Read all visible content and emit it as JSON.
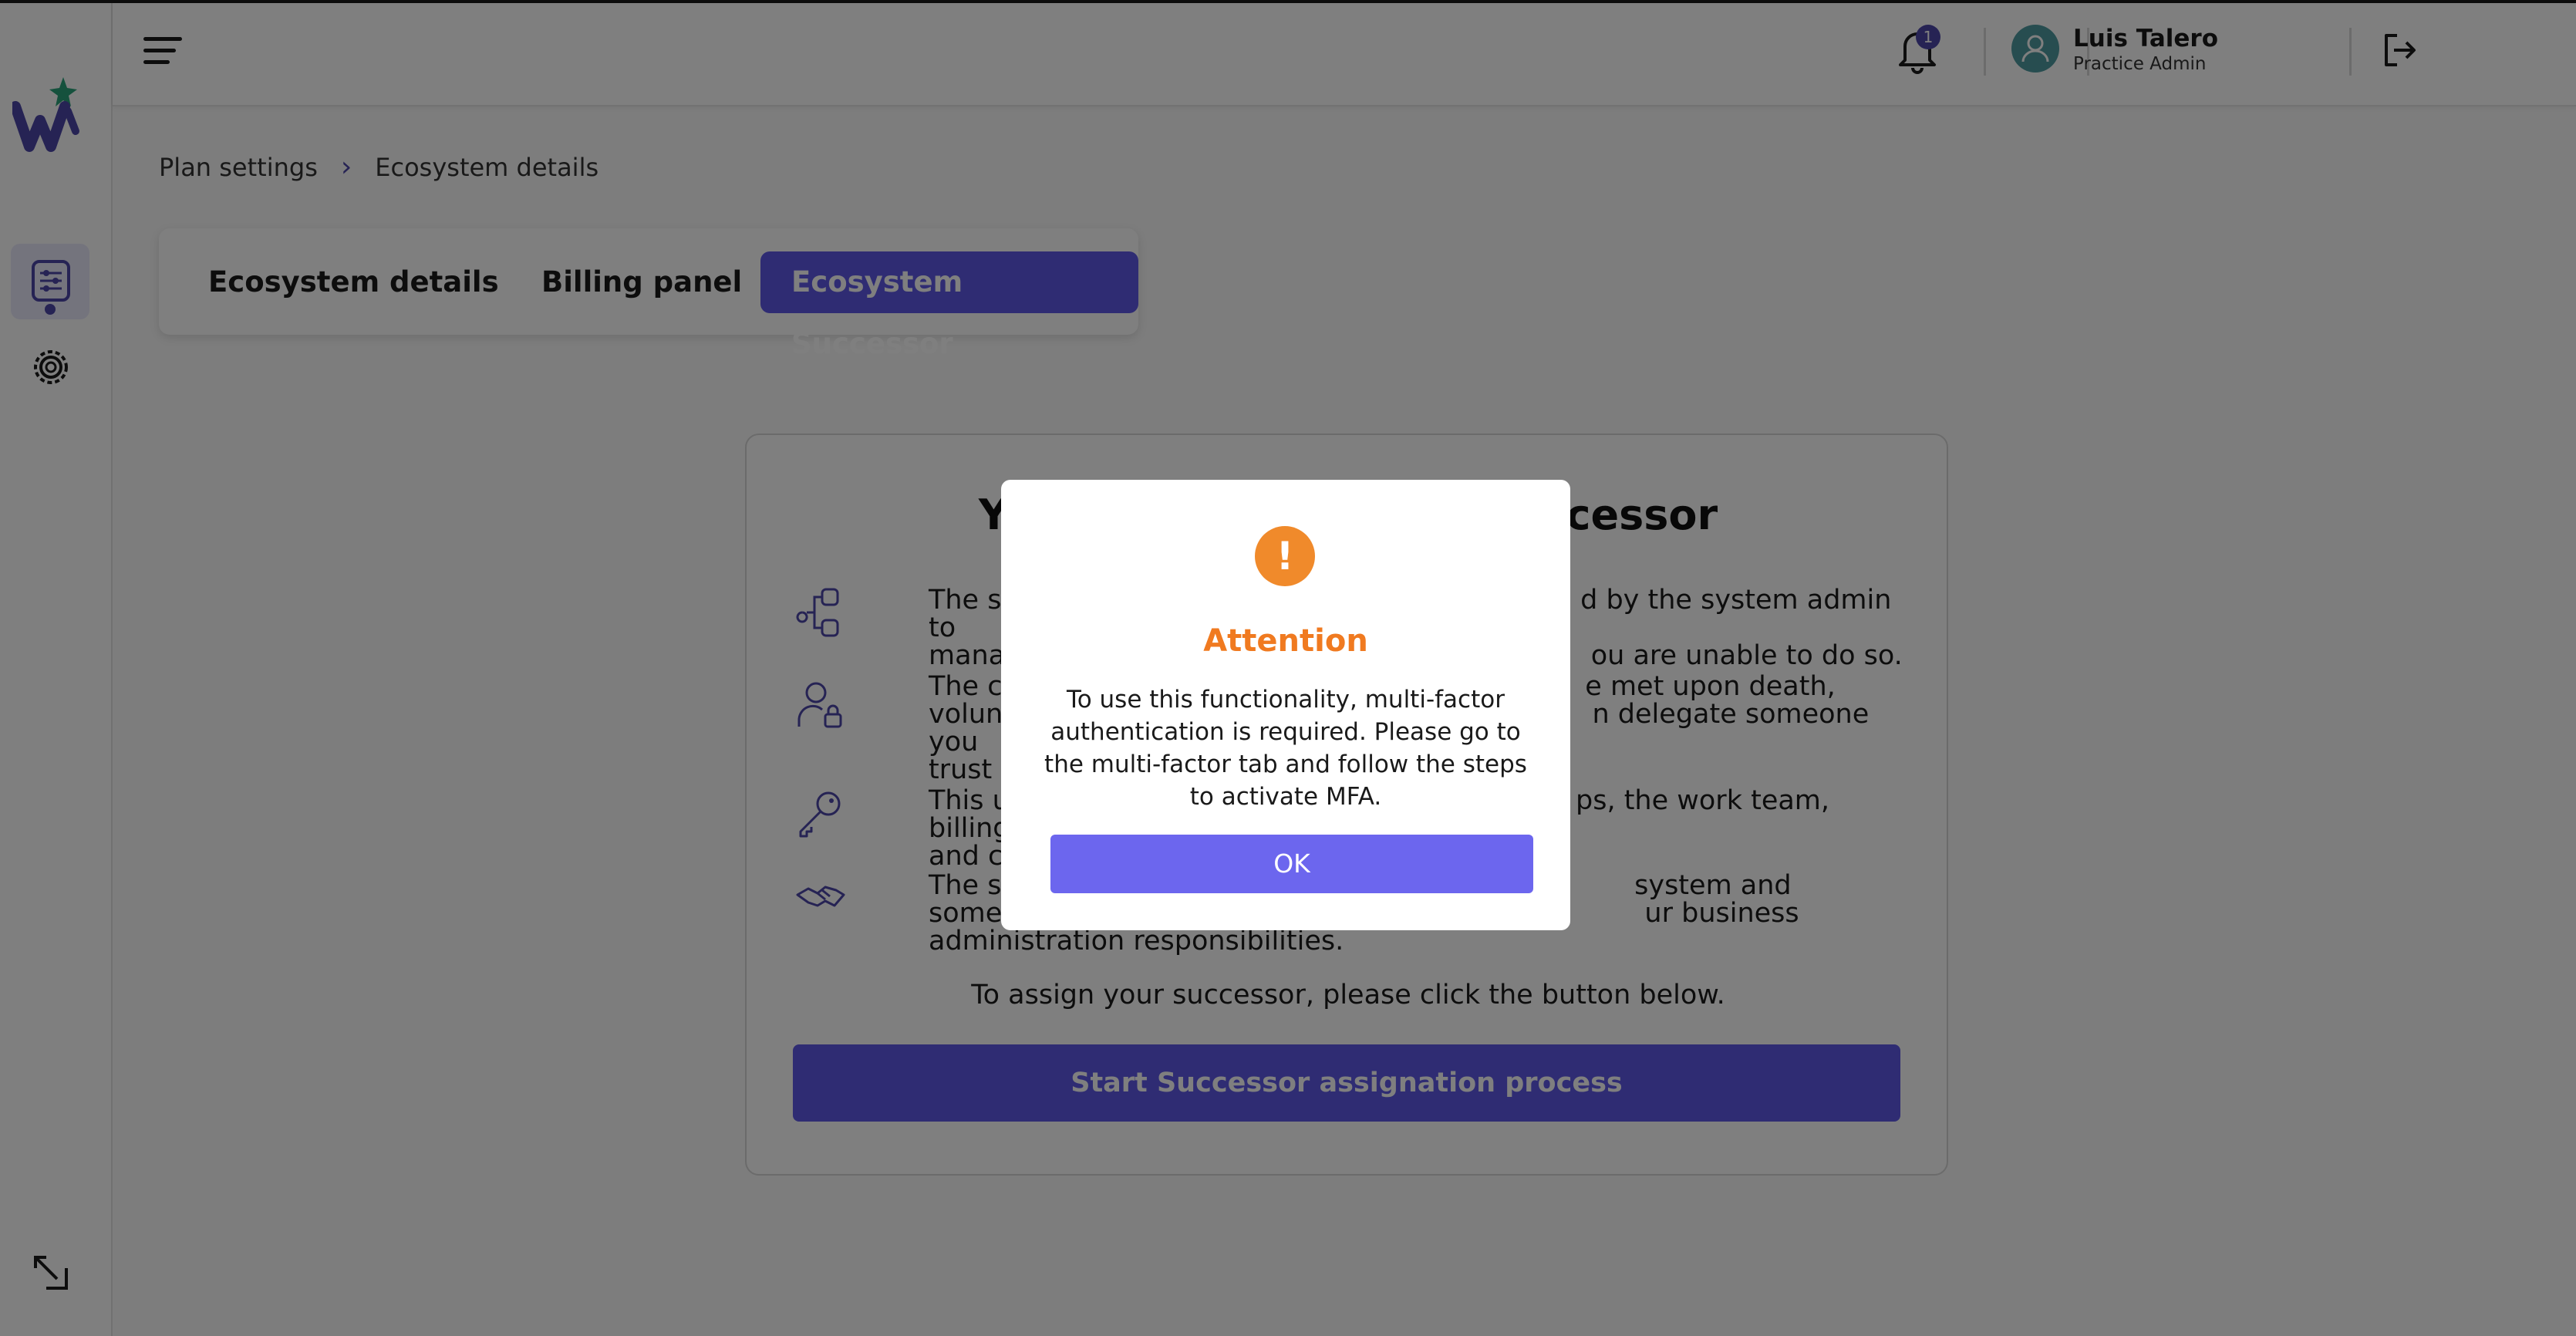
{
  "header": {
    "notification_count": "1",
    "user_name": "Luis Talero",
    "user_role": "Practice Admin"
  },
  "breadcrumb": {
    "items": [
      "Plan settings",
      "Ecosystem details"
    ]
  },
  "tabs": [
    {
      "label": "Ecosystem details",
      "active": false
    },
    {
      "label": "Billing panel",
      "active": false
    },
    {
      "label": "Ecosystem Successor",
      "active": true
    }
  ],
  "card": {
    "title_left": "Yo",
    "title_right": "uccessor",
    "features": [
      {
        "icon": "flow-icon",
        "line1": "The succ",
        "line2": "manage y",
        "line1_right": "d by the system admin to",
        "line2_right": "ou are unable to do so."
      },
      {
        "icon": "user-lock-icon",
        "line1": "The cond",
        "line2": "voluntary",
        "line3": "trust to m",
        "line1_right": "e met upon death,",
        "line2_right": "n delegate someone you"
      },
      {
        "icon": "key-icon",
        "line1": "This user",
        "line2": "and contr",
        "line1_right": "ps, the work team, billing,"
      },
      {
        "icon": "handshake-icon",
        "line1": "The succ",
        "line2": "someone",
        "line3": "administration responsibilities.",
        "line1_right": "system and",
        "line2_right": "ur business"
      }
    ],
    "assign_text": "To assign your successor, please click the button below.",
    "start_button": "Start Successor assignation process"
  },
  "modal": {
    "icon_glyph": "!",
    "title": "Attention",
    "body": "To use this functionality, multi-factor authentication is required. Please go to the multi-factor tab and follow the steps to activate MFA.",
    "ok_label": "OK"
  },
  "colors": {
    "accent": "#5e58e6",
    "warning": "#f08a2b"
  }
}
